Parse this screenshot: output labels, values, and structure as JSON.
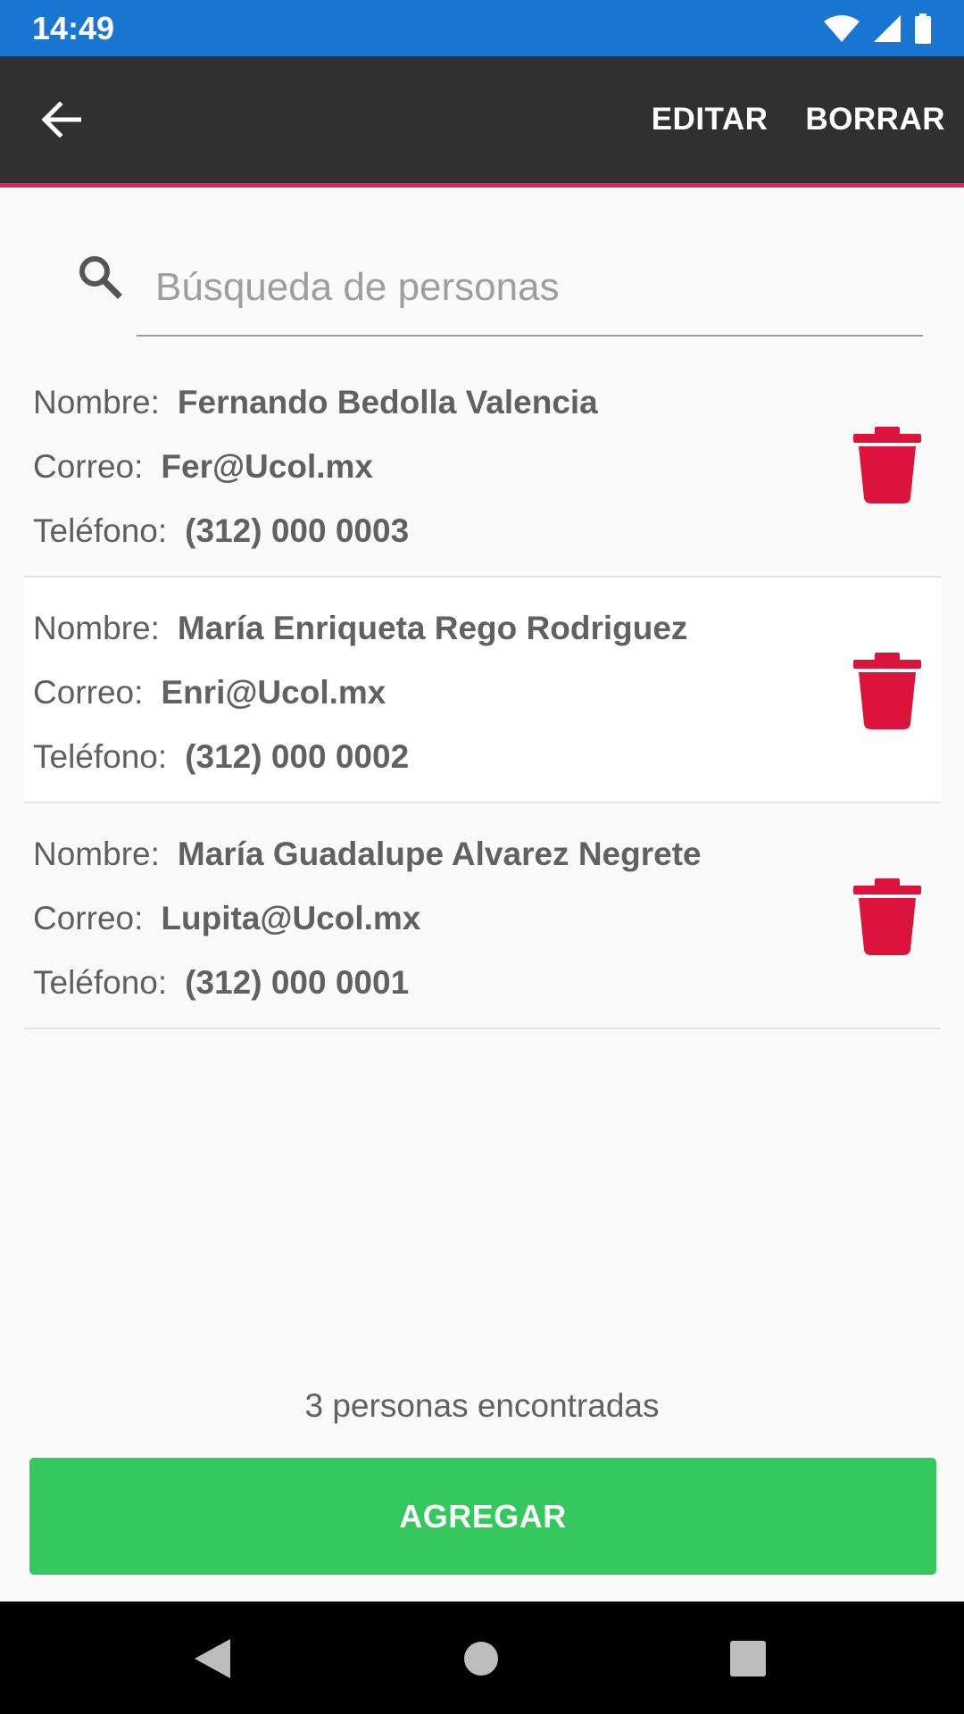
{
  "status_bar": {
    "time": "14:49",
    "icons": [
      "wifi-icon",
      "signal-icon",
      "battery-icon"
    ]
  },
  "toolbar": {
    "back_icon": "arrow-back-icon",
    "edit_label": "EDITAR",
    "delete_label": "BORRAR",
    "accent_color": "#e91e63"
  },
  "search": {
    "placeholder": "Búsqueda de personas",
    "value": ""
  },
  "labels": {
    "name": "Nombre:",
    "email": "Correo:",
    "phone": "Teléfono:"
  },
  "people": [
    {
      "name": "Fernando Bedolla Valencia",
      "email": "Fer@Ucol.mx",
      "phone": "(312) 000 0003"
    },
    {
      "name": "María Enriqueta Rego Rodriguez",
      "email": "Enri@Ucol.mx",
      "phone": "(312) 000 0002"
    },
    {
      "name": "María Guadalupe Alvarez Negrete",
      "email": "Lupita@Ucol.mx",
      "phone": "(312) 000 0001"
    }
  ],
  "footer": {
    "count_text": "3 personas encontradas",
    "add_label": "AGREGAR"
  },
  "colors": {
    "status_bar": "#1976d2",
    "toolbar": "#303030",
    "trash": "#dc143c",
    "add_button": "#35c85e"
  }
}
